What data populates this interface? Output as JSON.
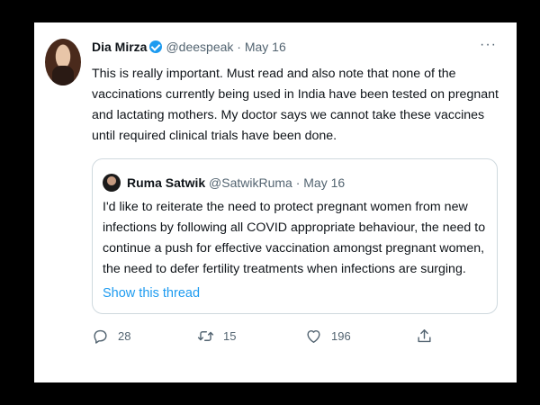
{
  "tweet": {
    "author_name": "Dia Mirza",
    "handle": "@deespeak",
    "date": "· May 16",
    "more": "···",
    "text": "This is really important. Must read and also note that none of the vaccinations currently being used in India have been tested on pregnant and lactating mothers. My doctor says we cannot take these vaccines until required clinical trials have been done.",
    "verified": true
  },
  "quote": {
    "author_name": "Ruma Satwik",
    "handle": "@SatwikRuma",
    "date": "· May 16",
    "text": "I'd like to reiterate the need to protect pregnant women from new infections by following all COVID appropriate behaviour, the need to continue a push for effective vaccination amongst pregnant women, the need to defer fertility treatments when infections are surging.",
    "link": "Show this thread"
  },
  "actions": {
    "reply": {
      "icon": "reply-icon",
      "count": "28"
    },
    "retweet": {
      "icon": "retweet-icon",
      "count": "15"
    },
    "like": {
      "icon": "heart-icon",
      "count": "196"
    },
    "share": {
      "icon": "share-icon"
    }
  },
  "colors": {
    "accent": "#1d9bf0",
    "muted": "#536471",
    "text": "#0f1419",
    "border": "#cfd9de"
  }
}
